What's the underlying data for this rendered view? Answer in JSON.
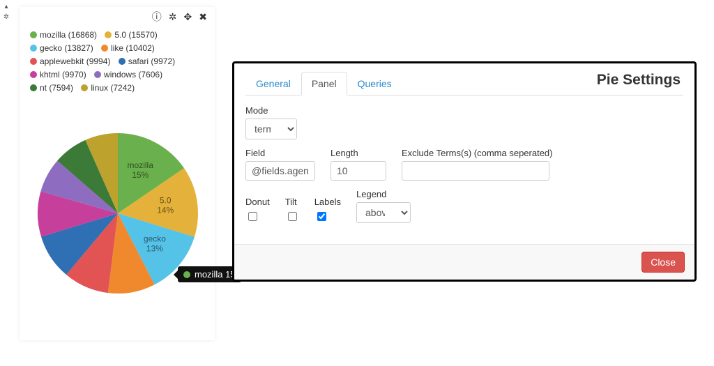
{
  "left_icons": {
    "up": "▴",
    "gear": "✲"
  },
  "toolbar": {
    "info": "ⓘ",
    "gear": "✲",
    "move": "✥",
    "close": "✖"
  },
  "legend_items": [
    {
      "label": "mozilla",
      "count": 16868,
      "color": "#6ab04c"
    },
    {
      "label": "5.0",
      "count": 15570,
      "color": "#e4b13a"
    },
    {
      "label": "gecko",
      "count": 13827,
      "color": "#55c2e8"
    },
    {
      "label": "like",
      "count": 10402,
      "color": "#f0892d"
    },
    {
      "label": "applewebkit",
      "count": 9994,
      "color": "#e15453"
    },
    {
      "label": "safari",
      "count": 9972,
      "color": "#2f6fb3"
    },
    {
      "label": "khtml",
      "count": 9970,
      "color": "#c53f9b"
    },
    {
      "label": "windows",
      "count": 7606,
      "color": "#8e6dc0"
    },
    {
      "label": "nt",
      "count": 7594,
      "color": "#3c7a38"
    },
    {
      "label": "linux",
      "count": 7242,
      "color": "#bda22e"
    }
  ],
  "chart_data": {
    "type": "pie",
    "title": "",
    "series": [
      {
        "name": "mozilla",
        "value": 16868,
        "pct": 15,
        "color": "#6ab04c"
      },
      {
        "name": "5.0",
        "value": 15570,
        "pct": 14,
        "color": "#e4b13a"
      },
      {
        "name": "gecko",
        "value": 13827,
        "pct": 13,
        "color": "#55c2e8"
      },
      {
        "name": "like",
        "value": 10402,
        "pct": 10,
        "color": "#f0892d"
      },
      {
        "name": "applewebkit",
        "value": 9994,
        "pct": 9,
        "color": "#e15453"
      },
      {
        "name": "safari",
        "value": 9972,
        "pct": 9,
        "color": "#2f6fb3"
      },
      {
        "name": "khtml",
        "value": 9970,
        "pct": 9,
        "color": "#c53f9b"
      },
      {
        "name": "windows",
        "value": 7606,
        "pct": 7,
        "color": "#8e6dc0"
      },
      {
        "name": "nt",
        "value": 7594,
        "pct": 7,
        "color": "#3c7a38"
      },
      {
        "name": "linux",
        "value": 7242,
        "pct": 7,
        "color": "#bda22e"
      }
    ],
    "labels_shown": [
      "mozilla",
      "5.0",
      "gecko"
    ],
    "legend_position": "above"
  },
  "tooltip": {
    "color": "#6ab04c",
    "text": "mozilla 15"
  },
  "settings": {
    "title": "Pie Settings",
    "tabs": {
      "general": "General",
      "panel": "Panel",
      "queries": "Queries",
      "active": "Panel"
    },
    "mode_label": "Mode",
    "mode_value": "terms",
    "field_label": "Field",
    "field_value": "@fields.agent",
    "length_label": "Length",
    "length_value": "10",
    "exclude_label": "Exclude Terms(s) (comma seperated)",
    "exclude_value": "",
    "donut_label": "Donut",
    "donut_checked": false,
    "tilt_label": "Tilt",
    "tilt_checked": false,
    "labels_label": "Labels",
    "labels_checked": true,
    "legend_label": "Legend",
    "legend_value": "above",
    "close_label": "Close"
  }
}
